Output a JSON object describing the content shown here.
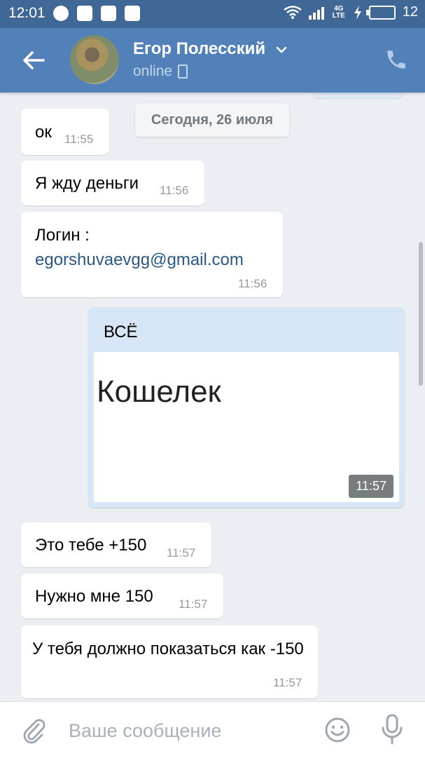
{
  "status_bar": {
    "time": "12:01",
    "network": "4G LTE",
    "battery": "12"
  },
  "header": {
    "contact_name": "Егор Полесский",
    "status": "online"
  },
  "date_separator": "Сегодня, 26 июля",
  "messages": [
    {
      "text": "ок",
      "time": "11:55"
    },
    {
      "text": "Я жду деньги",
      "time": "11:56"
    },
    {
      "text": "Логин :",
      "link": "egorshuvaevgg@gmail.com",
      "time": "11:56"
    },
    {
      "text": "ВСЁ",
      "attachment_text": "Кошелек",
      "time": "11:57",
      "outgoing": true
    },
    {
      "text": "Это тебе +150",
      "time": "11:57"
    },
    {
      "text": "Нужно мне 150",
      "time": "11:57"
    },
    {
      "text": "У тебя должно показаться как -150",
      "time": "11:57"
    }
  ],
  "composer": {
    "placeholder": "Ваше сообщение"
  },
  "colors": {
    "header": "#5181b8",
    "status_bar": "#3f6897",
    "background": "#ebeef2",
    "outgoing_bubble": "#d7e6f6",
    "link": "#2a5885"
  }
}
